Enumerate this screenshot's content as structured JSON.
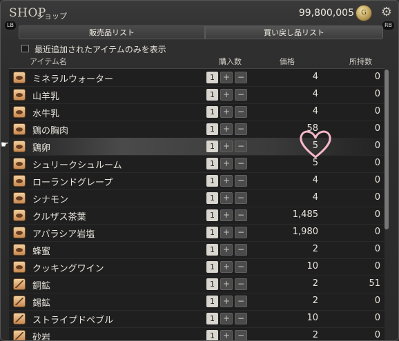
{
  "header": {
    "title": "SHOP",
    "subtitle": "ショップ",
    "gil": "99,800,005",
    "lb": "LB",
    "rb": "RB"
  },
  "tabs": {
    "sale": "販売品リスト",
    "buyback": "買い戻し品リスト"
  },
  "filter": {
    "label": "最近追加されたアイテムのみを表示",
    "checked": false
  },
  "columns": {
    "item": "アイテム名",
    "quantity": "購入数",
    "price": "価格",
    "owned": "所持数"
  },
  "items": [
    {
      "name": "ミネラルウォーター",
      "qty": "1",
      "price": "4",
      "owned": "0",
      "icon": "food-icon"
    },
    {
      "name": "山羊乳",
      "qty": "1",
      "price": "4",
      "owned": "0",
      "icon": "food-icon"
    },
    {
      "name": "水牛乳",
      "qty": "1",
      "price": "4",
      "owned": "0",
      "icon": "food-icon"
    },
    {
      "name": "鶏の胸肉",
      "qty": "1",
      "price": "58",
      "owned": "0",
      "icon": "food-icon"
    },
    {
      "name": "鶏卵",
      "qty": "1",
      "price": "5",
      "owned": "0",
      "icon": "food-icon"
    },
    {
      "name": "シュリークシュルーム",
      "qty": "1",
      "price": "5",
      "owned": "0",
      "icon": "food-icon"
    },
    {
      "name": "ローランドグレープ",
      "qty": "1",
      "price": "4",
      "owned": "0",
      "icon": "food-icon"
    },
    {
      "name": "シナモン",
      "qty": "1",
      "price": "4",
      "owned": "0",
      "icon": "food-icon"
    },
    {
      "name": "クルザス茶葉",
      "qty": "1",
      "price": "1,485",
      "owned": "0",
      "icon": "food-icon"
    },
    {
      "name": "アバラシア岩塩",
      "qty": "1",
      "price": "1,980",
      "owned": "0",
      "icon": "food-icon"
    },
    {
      "name": "蜂蜜",
      "qty": "1",
      "price": "2",
      "owned": "0",
      "icon": "food-icon"
    },
    {
      "name": "クッキングワイン",
      "qty": "1",
      "price": "10",
      "owned": "0",
      "icon": "food-icon"
    },
    {
      "name": "銅鉱",
      "qty": "1",
      "price": "2",
      "owned": "51",
      "icon": "ore-icon"
    },
    {
      "name": "錫鉱",
      "qty": "1",
      "price": "2",
      "owned": "0",
      "icon": "ore-icon"
    },
    {
      "name": "ストライプドペブル",
      "qty": "1",
      "price": "10",
      "owned": "0",
      "icon": "ore-icon"
    },
    {
      "name": "砂岩",
      "qty": "1",
      "price": "2",
      "owned": "0",
      "icon": "ore-icon"
    }
  ],
  "buttons": {
    "plus": "+",
    "minus": "−"
  },
  "colors": {
    "selected_row": "#4a4a4a",
    "heart": "#f5b8c8"
  }
}
